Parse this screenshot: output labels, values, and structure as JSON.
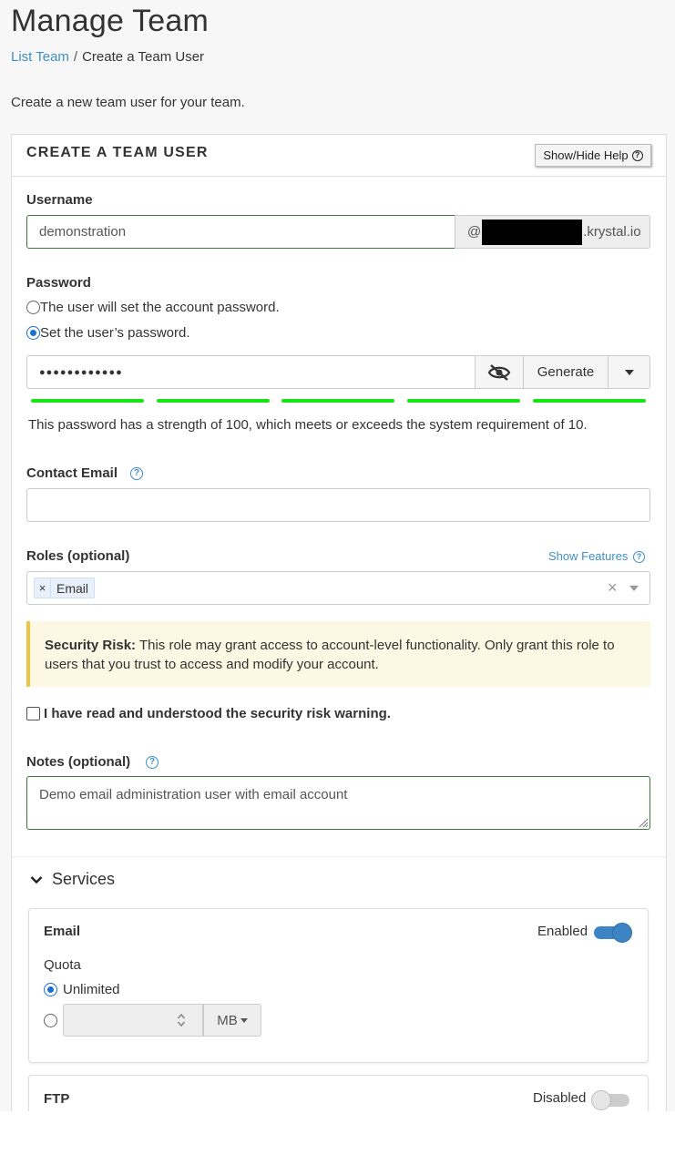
{
  "page": {
    "title": "Manage Team",
    "breadcrumb": {
      "link": "List Team",
      "separator": "/",
      "current": "Create a Team User"
    },
    "intro": "Create a new team user for your team."
  },
  "form": {
    "heading": "CREATE A TEAM USER",
    "help_button": "Show/Hide Help",
    "username": {
      "label": "Username",
      "value": "demonstration",
      "domain_prefix": "@",
      "domain_suffix": ".krystal.io"
    },
    "password": {
      "label": "Password",
      "option_user_sets": "The user will set the account password.",
      "option_set_now": "Set the user’s password.",
      "selected": "option_set_now",
      "masked_value": "●●●●●●●●●●●●",
      "generate_label": "Generate",
      "strength_segments": 5,
      "strength_text": "This password has a strength of 100, which meets or exceeds the system requirement of 10."
    },
    "contact_email": {
      "label": "Contact Email",
      "value": ""
    },
    "roles": {
      "label": "Roles (optional)",
      "show_features": "Show Features",
      "selected": [
        "Email"
      ]
    },
    "security_warning": {
      "title": "Security Risk:",
      "text": " This role may grant access to account-level functionality. Only grant this role to users that you trust to access and modify your account."
    },
    "acknowledge": {
      "label": "I have read and understood the security risk warning.",
      "checked": false
    },
    "notes": {
      "label": "Notes (optional)",
      "value": "Demo email administration user with email account"
    }
  },
  "services": {
    "heading": "Services",
    "email": {
      "title": "Email",
      "status": "Enabled",
      "enabled": true,
      "quota_label": "Quota",
      "unlimited_label": "Unlimited",
      "quota_selected": "unlimited",
      "quota_value": "",
      "unit": "MB"
    },
    "ftp": {
      "title": "FTP",
      "status": "Disabled",
      "enabled": false
    }
  },
  "colors": {
    "link": "#3d8fc7",
    "accent": "#1a6fd1",
    "strength": "#18e418",
    "warning_bg": "#fcf8e3",
    "warning_border": "#f0c348",
    "valid_border": "#3c763d"
  }
}
